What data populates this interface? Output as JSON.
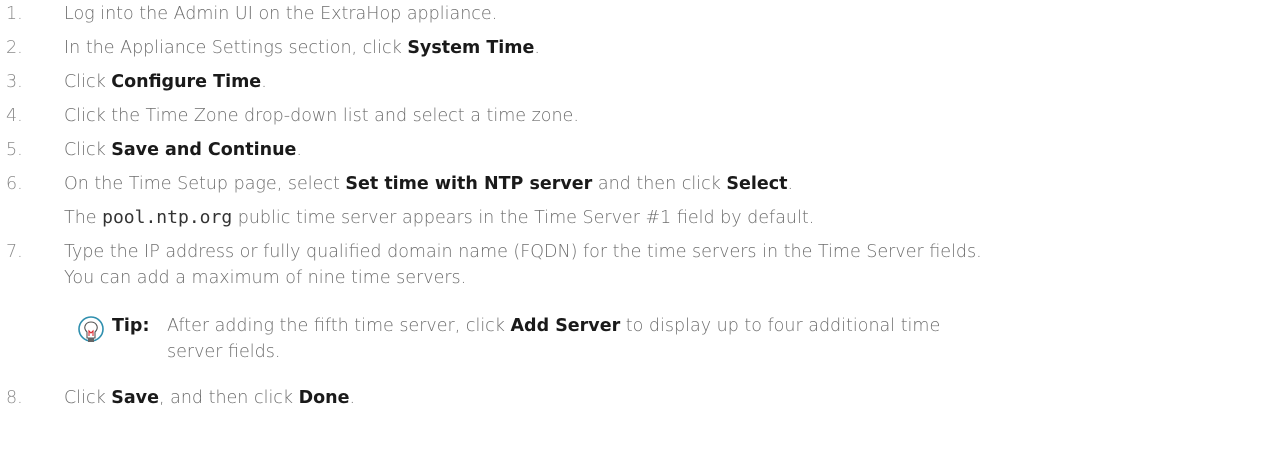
{
  "steps": [
    {
      "num": "1.",
      "parts": [
        "Log into the Admin UI on the ExtraHop appliance."
      ]
    },
    {
      "num": "2.",
      "pre": "In the Appliance Settings section, click ",
      "bold": "System Time",
      "post": "."
    },
    {
      "num": "3.",
      "pre": "Click ",
      "bold": "Configure Time",
      "post": "."
    },
    {
      "num": "4.",
      "text": "Click the Time Zone drop-down list and select a time zone."
    },
    {
      "num": "5.",
      "pre": "Click ",
      "bold": "Save and Continue",
      "post": "."
    },
    {
      "num": "6.",
      "pre": "On the Time Setup page, select ",
      "bold": "Set time with NTP server",
      "mid": " and then click ",
      "bold2": "Select",
      "post": ".",
      "note_pre": "The ",
      "note_code": "pool.ntp.org",
      "note_post": " public time server appears in the Time Server #1 field by default."
    },
    {
      "num": "7.",
      "text": "Type the IP address or fully qualified domain name (FQDN) for the time servers in the Time Server fields.",
      "text2": "You can add a maximum of nine time servers."
    },
    {
      "num": "8.",
      "pre": "Click ",
      "bold": "Save",
      "mid": ", and then click ",
      "bold2": "Done",
      "post": "."
    }
  ],
  "tip": {
    "label": "Tip:",
    "pre": "After adding the fifth time server, click ",
    "bold": "Add Server",
    "post": " to display up to four additional time",
    "line2": "server fields."
  }
}
